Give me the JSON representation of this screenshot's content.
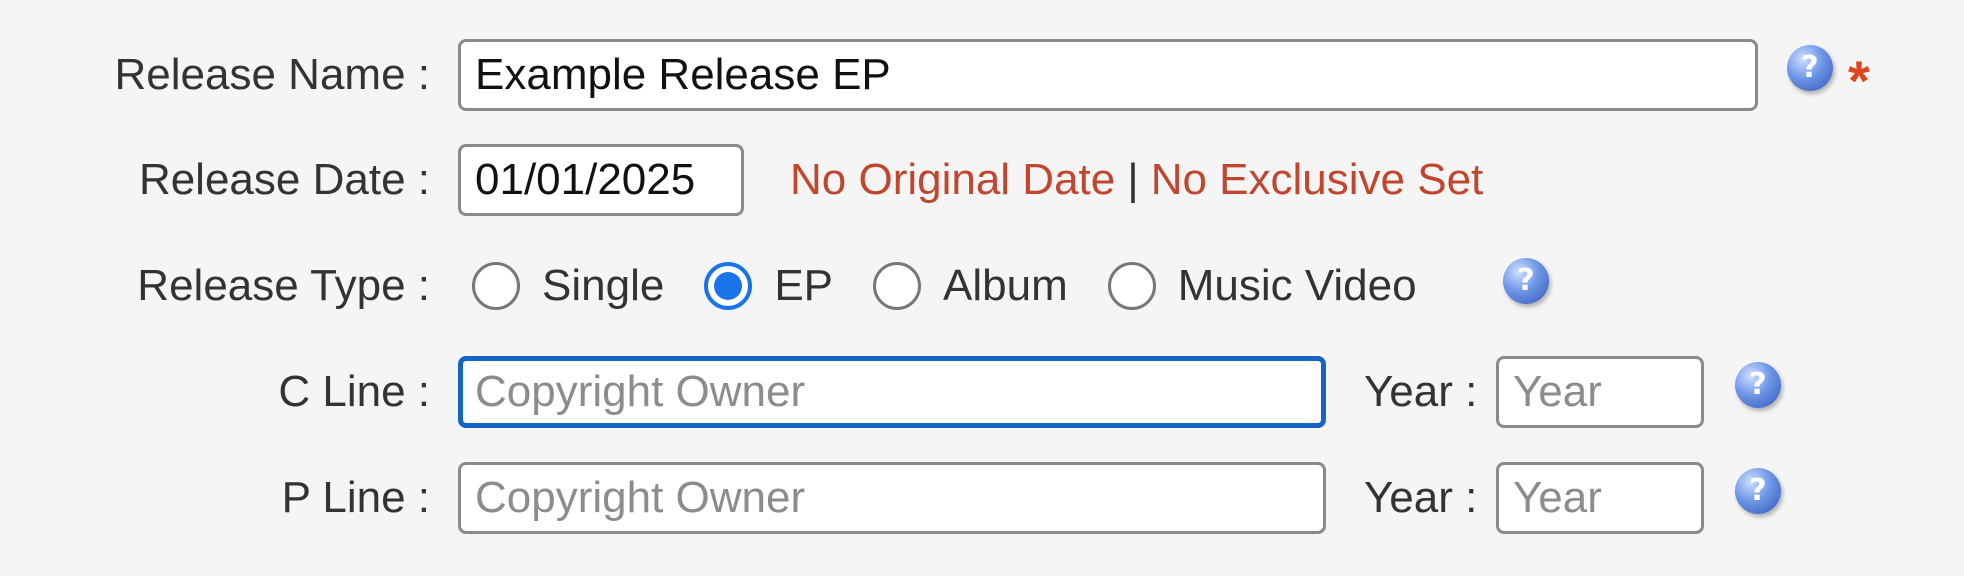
{
  "release_name": {
    "label": "Release Name :",
    "value": "Example Release EP",
    "help_icon": "question-circle-icon",
    "required_marker": "*"
  },
  "release_date": {
    "label": "Release Date :",
    "value": "01/01/2025",
    "links": [
      "No Original Date",
      "No Exclusive Set"
    ],
    "separator": "|"
  },
  "release_type": {
    "label": "Release Type :",
    "options": [
      {
        "label": "Single",
        "checked": false
      },
      {
        "label": "EP",
        "checked": true
      },
      {
        "label": "Album",
        "checked": false
      },
      {
        "label": "Music Video",
        "checked": false
      }
    ],
    "help_icon": "question-circle-icon"
  },
  "c_line": {
    "label": "C Line :",
    "value": "",
    "placeholder": "Copyright Owner",
    "year_label": "Year :",
    "year_value": "",
    "year_placeholder": "Year",
    "focused": true,
    "help_icon": "question-circle-icon"
  },
  "p_line": {
    "label": "P Line :",
    "value": "",
    "placeholder": "Copyright Owner",
    "year_label": "Year :",
    "year_value": "",
    "year_placeholder": "Year",
    "help_icon": "question-circle-icon"
  },
  "help_glyph": "?",
  "colors": {
    "focus_border": "#1565c8",
    "radio_checked": "#1a73e8",
    "link": "#c0462e",
    "required": "#e0451f"
  }
}
